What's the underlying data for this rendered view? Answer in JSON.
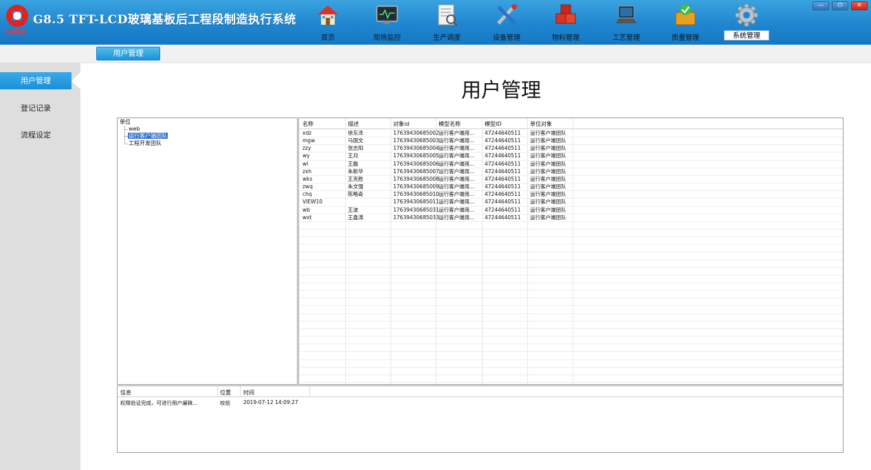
{
  "header": {
    "logo_text": "中国建材",
    "title": "G8.5 TFT-LCD玻璃基板后工程段制造执行系统",
    "nav": [
      {
        "label": "首页",
        "icon": "home-icon"
      },
      {
        "label": "现场监控",
        "icon": "monitor-icon"
      },
      {
        "label": "生产调度",
        "icon": "schedule-icon"
      },
      {
        "label": "设备管理",
        "icon": "tools-icon"
      },
      {
        "label": "物料管理",
        "icon": "boxes-icon"
      },
      {
        "label": "工艺管理",
        "icon": "laptop-icon"
      },
      {
        "label": "质量管理",
        "icon": "quality-icon"
      },
      {
        "label": "系统管理",
        "icon": "gear-icon"
      }
    ],
    "active_nav": "系统管理",
    "window_controls": {
      "minimize": "—",
      "power": "⏻",
      "close": "✕"
    }
  },
  "subbar": {
    "tab": "用户管理"
  },
  "sidebar": {
    "items": [
      {
        "label": "用户管理"
      },
      {
        "label": "登记记录"
      },
      {
        "label": "流程设定"
      }
    ]
  },
  "page_title": "用户管理",
  "tree": {
    "root": "单位",
    "children": [
      "web",
      "运行客户端团队",
      "工程开发团队"
    ],
    "selected": "运行客户端团队"
  },
  "table": {
    "columns": [
      "名称",
      "描述",
      "对象id",
      "模型名称",
      "模型ID",
      "单位对象"
    ],
    "rows": [
      [
        "xdz",
        "徐东泽",
        "17639430685002",
        "运行客户端用...",
        "47244640511",
        "运行客户端团队"
      ],
      [
        "mgw",
        "马国文",
        "17639430685003",
        "运行客户端用...",
        "47244640511",
        "运行客户端团队"
      ],
      [
        "zzy",
        "张志阳",
        "17639430685004",
        "运行客户端用...",
        "47244640511",
        "运行客户端团队"
      ],
      [
        "wy",
        "王月",
        "17639430685005",
        "运行客户端用...",
        "47244640511",
        "运行客户端团队"
      ],
      [
        "wl",
        "王磊",
        "17639430685006",
        "运行客户端用...",
        "47244640511",
        "运行客户端团队"
      ],
      [
        "zxh",
        "朱新华",
        "17639430685007",
        "运行客户端用...",
        "47244640511",
        "运行客户端团队"
      ],
      [
        "wks",
        "王克胜",
        "17639430685008",
        "运行客户端用...",
        "47244640511",
        "运行客户端团队"
      ],
      [
        "zwq",
        "朱文强",
        "17639430685009",
        "运行客户端用...",
        "47244640511",
        "运行客户端团队"
      ],
      [
        "chq",
        "陈略奇",
        "17639430685010",
        "运行客户端用...",
        "47244640511",
        "运行客户端团队"
      ],
      [
        "VIEW10",
        "",
        "17639430685011",
        "运行客户端用...",
        "47244640511",
        "运行客户端团队"
      ],
      [
        "wb",
        "王波",
        "17639430685031",
        "运行客户端用...",
        "47244640511",
        "运行客户端团队"
      ],
      [
        "wxt",
        "王鑫涛",
        "17639430685033",
        "运行客户端用...",
        "47244640511",
        "运行客户端团队"
      ]
    ]
  },
  "log": {
    "columns": [
      "信息",
      "位置",
      "时间"
    ],
    "rows": [
      [
        "权限验证完成，可进行用户编辑...",
        "校验",
        "2019-07-12 14:09:27"
      ]
    ]
  },
  "colors": {
    "header_blue": "#1f86cf",
    "accent": "#1b90d6",
    "close_red": "#c8281c",
    "selection": "#2f6fd0"
  }
}
